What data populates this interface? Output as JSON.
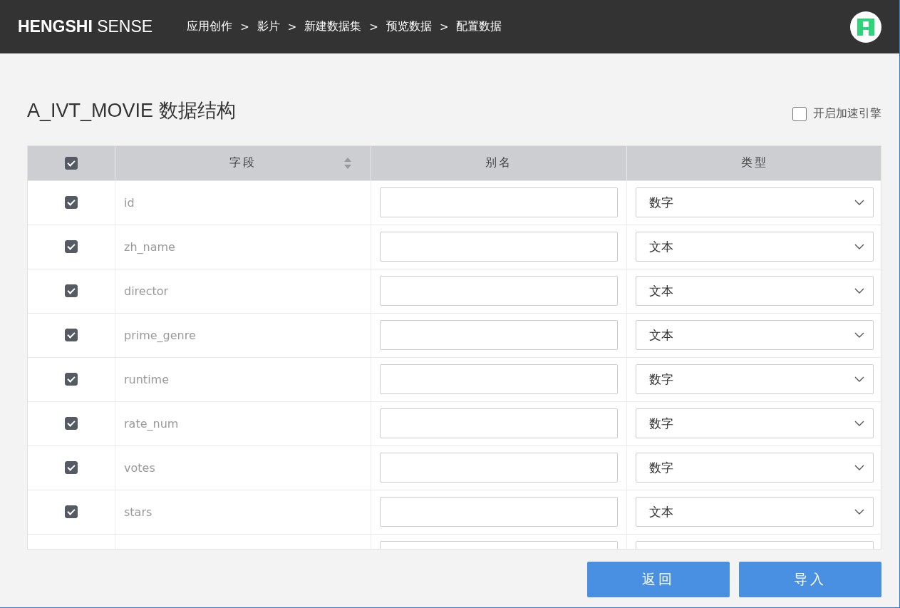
{
  "header": {
    "logo_bold": "HENGSHI",
    "logo_light": "SENSE",
    "breadcrumbs": [
      "应用创作",
      "影片",
      "新建数据集",
      "预览数据",
      "配置数据"
    ],
    "separator": ">"
  },
  "title": "A_IVT_MOVIE 数据结构",
  "accelerate": {
    "label": "开启加速引擎",
    "checked": false
  },
  "table": {
    "select_all_checked": true,
    "columns": [
      "字段",
      "别名",
      "类型"
    ],
    "rows": [
      {
        "checked": true,
        "name": "id",
        "type": "数字"
      },
      {
        "checked": true,
        "name": "zh_name",
        "type": "文本"
      },
      {
        "checked": true,
        "name": "director",
        "type": "文本"
      },
      {
        "checked": true,
        "name": "prime_genre",
        "type": "文本"
      },
      {
        "checked": true,
        "name": "runtime",
        "type": "数字"
      },
      {
        "checked": true,
        "name": "rate_num",
        "type": "数字"
      },
      {
        "checked": true,
        "name": "votes",
        "type": "数字"
      },
      {
        "checked": true,
        "name": "stars",
        "type": "文本"
      }
    ]
  },
  "buttons": [
    "返回",
    "导入"
  ]
}
